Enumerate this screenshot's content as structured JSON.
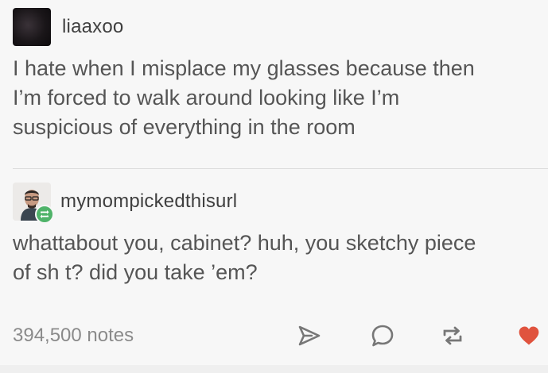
{
  "post": {
    "entries": [
      {
        "username": "liaaxoo",
        "avatar": "avatar-dark",
        "text": "I hate when I misplace my glasses because then I’m forced to walk around looking like I’m suspicious of everything in the room"
      },
      {
        "username": "mymompickedthisurl",
        "avatar": "avatar-photo-with-reblog-badge",
        "text": "whattabout you, cabinet? huh, you sketchy piece of sh t? did you take ’em?"
      }
    ],
    "footer": {
      "notes": "394,500 notes",
      "icons": [
        "share-icon",
        "reply-icon",
        "reblog-icon",
        "like-icon"
      ]
    }
  },
  "colors": {
    "background": "#f7f7f7",
    "text": "#555555",
    "muted": "#8a8a8a",
    "like": "#e0533e",
    "reblog_badge": "#4fb369"
  }
}
